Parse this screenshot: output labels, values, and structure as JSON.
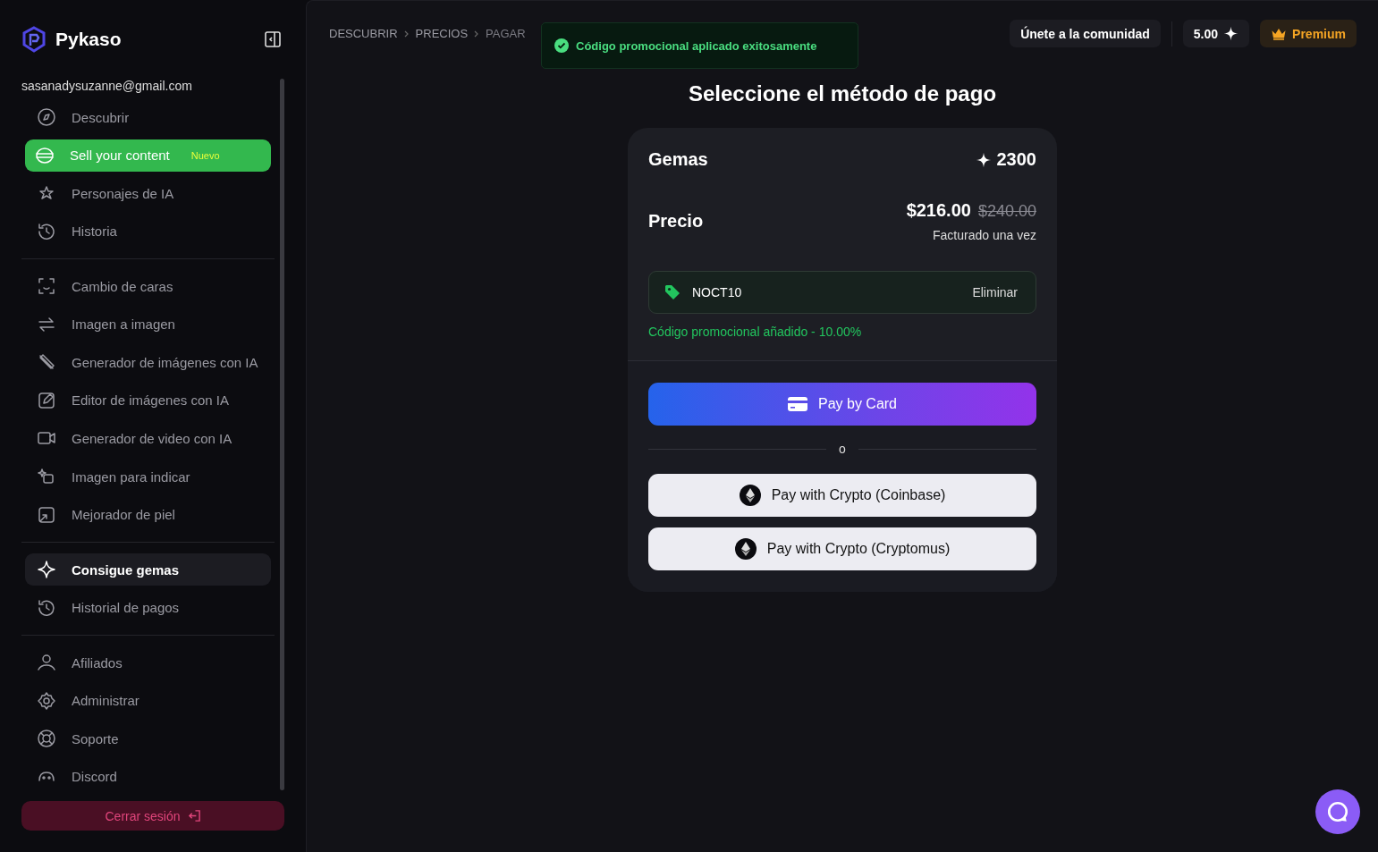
{
  "brand": {
    "name": "Pykaso"
  },
  "sidebar": {
    "email": "sasanadysuzanne@gmail.com",
    "groups": [
      [
        {
          "label": "Descubrir",
          "kind": "plain",
          "selected": false
        },
        {
          "label": "Sell your content",
          "kind": "highlight",
          "badge": "Nuevo",
          "selected": false
        },
        {
          "label": "Personajes de IA",
          "kind": "plain",
          "selected": false
        },
        {
          "label": "Historia",
          "kind": "plain",
          "selected": false
        }
      ],
      [
        {
          "label": "Cambio de caras",
          "kind": "plain",
          "selected": false
        },
        {
          "label": "Imagen a imagen",
          "kind": "plain",
          "selected": false
        },
        {
          "label": "Generador de imágenes con IA",
          "kind": "plain",
          "selected": false
        },
        {
          "label": "Editor de imágenes con IA",
          "kind": "plain",
          "selected": false
        },
        {
          "label": "Generador de video con IA",
          "kind": "plain",
          "selected": false
        },
        {
          "label": "Imagen para indicar",
          "kind": "plain",
          "selected": false
        },
        {
          "label": "Mejorador de piel",
          "kind": "plain",
          "selected": false
        }
      ],
      [
        {
          "label": "Consigue gemas",
          "kind": "plain",
          "selected": true
        },
        {
          "label": "Historial de pagos",
          "kind": "plain",
          "selected": false
        }
      ],
      [
        {
          "label": "Afiliados",
          "kind": "plain",
          "selected": false
        },
        {
          "label": "Administrar",
          "kind": "plain",
          "selected": false
        },
        {
          "label": "Soporte",
          "kind": "plain",
          "selected": false
        },
        {
          "label": "Discord",
          "kind": "plain",
          "selected": false
        }
      ]
    ],
    "logout": "Cerrar sesión"
  },
  "breadcrumb": [
    "DESCUBRIR",
    "PRECIOS",
    "PAGAR"
  ],
  "toast": "Código promocional aplicado exitosamente",
  "topbar": {
    "community": "Únete a la comunidad",
    "balance": "5.00",
    "premium": "Premium"
  },
  "title": "Seleccione el método de pago",
  "summary": {
    "gems_label": "Gemas",
    "gems": "2300",
    "price_label": "Precio",
    "price": "$216.00",
    "old_price": "$240.00",
    "billing": "Facturado una vez",
    "promo": {
      "code": "NOCT10",
      "remove": "Eliminar",
      "note": "Código promocional añadido - 10.00%"
    }
  },
  "payment": {
    "card": "Pay by Card",
    "separator": "o",
    "crypto": [
      "Pay with Crypto (Coinbase)",
      "Pay with Crypto (Cryptomus)"
    ]
  }
}
